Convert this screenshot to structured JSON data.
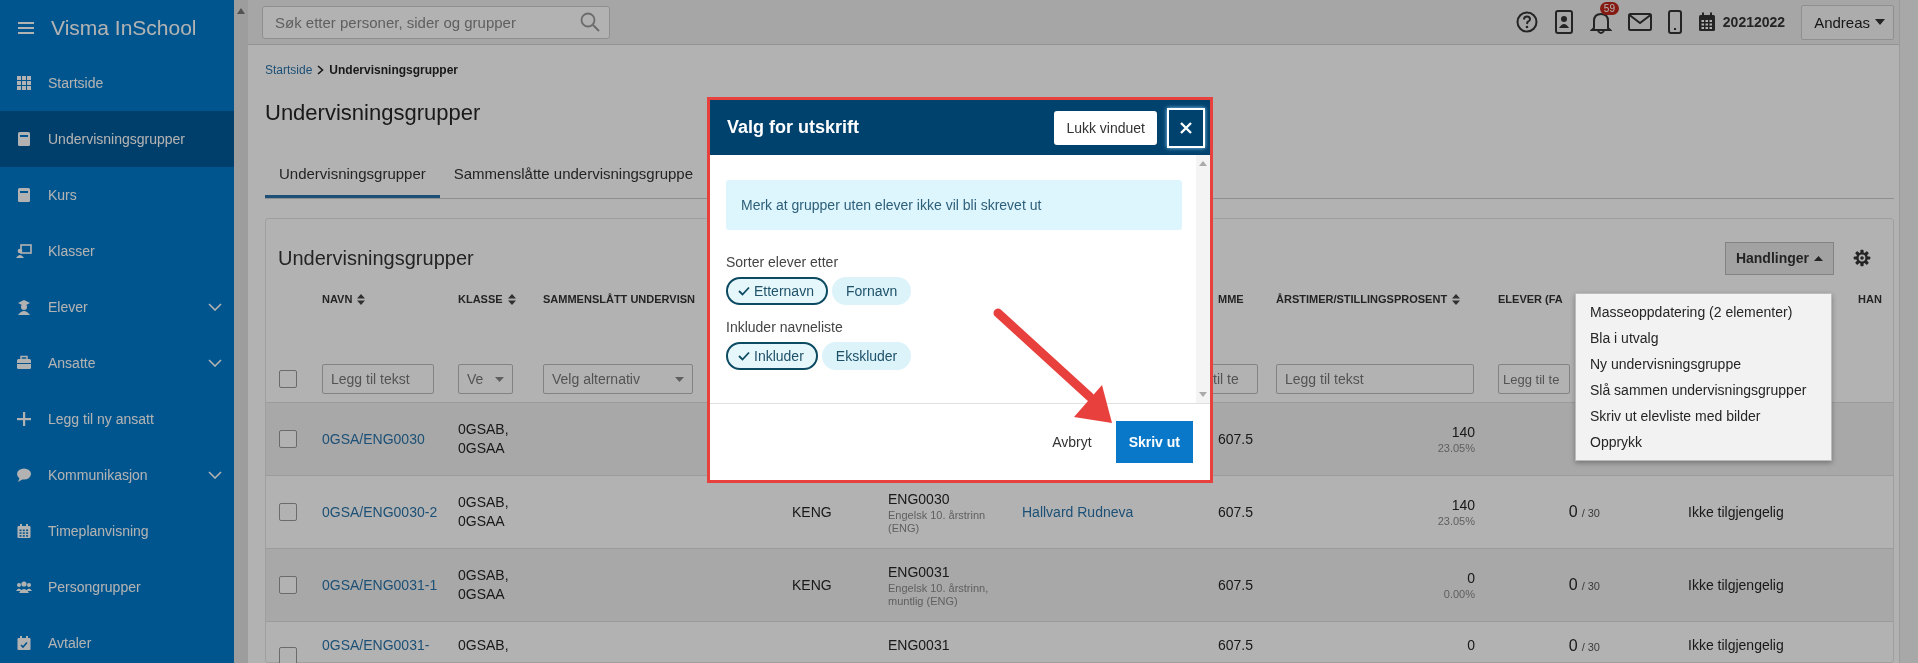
{
  "sidebar": {
    "brand": "Visma InSchool",
    "items": [
      {
        "label": "Startside",
        "selected": false,
        "has_submenu": false
      },
      {
        "label": "Undervisningsgrupper",
        "selected": true,
        "has_submenu": false
      },
      {
        "label": "Kurs",
        "selected": false,
        "has_submenu": false
      },
      {
        "label": "Klasser",
        "selected": false,
        "has_submenu": false
      },
      {
        "label": "Elever",
        "selected": false,
        "has_submenu": true
      },
      {
        "label": "Ansatte",
        "selected": false,
        "has_submenu": true
      },
      {
        "label": "Legg til ny ansatt",
        "selected": false,
        "has_submenu": false
      },
      {
        "label": "Kommunikasjon",
        "selected": false,
        "has_submenu": true
      },
      {
        "label": "Timeplanvisning",
        "selected": false,
        "has_submenu": false
      },
      {
        "label": "Persongrupper",
        "selected": false,
        "has_submenu": false
      },
      {
        "label": "Avtaler",
        "selected": false,
        "has_submenu": false
      }
    ]
  },
  "topbar": {
    "search": {
      "placeholder": "Søk etter personer, sider og grupper"
    },
    "notification_count": "59",
    "school_year": "20212022",
    "user": "Andreas"
  },
  "breadcrumb": [
    {
      "label": "Startside",
      "kind": "link"
    },
    {
      "label": "Undervisningsgrupper",
      "kind": "current"
    }
  ],
  "page_title": "Undervisningsgrupper",
  "tabs": [
    {
      "label": "Undervisningsgrupper",
      "selected": true
    },
    {
      "label": "Sammenslåtte undervisningsgruppe",
      "selected": false
    }
  ],
  "card": {
    "title": "Undervisningsgrupper",
    "actions_button": "Handlinger",
    "actions_menu": [
      "Masseoppdatering (2 elementer)",
      "Bla i utvalg",
      "Ny undervisningsgruppe",
      "Slå sammen undervisningsgrupper",
      "Skriv ut elevliste med bilder",
      "Opprykk"
    ]
  },
  "table": {
    "select_all": {
      "checked": false
    },
    "columns": [
      {
        "label": "NAVN",
        "sortable": true
      },
      {
        "label": "KLASSE",
        "sortable": true
      },
      {
        "label": "SAMMENSLÅTT UNDERVISN",
        "sortable": false
      },
      {
        "label": "MME",
        "sortable": false
      },
      {
        "label": "ÅRSTIMER/STILLINGSPROSENT",
        "sortable": true
      },
      {
        "label": "ELEVER (FA",
        "sortable": false
      },
      {
        "label": "HAN",
        "sortable": false
      }
    ],
    "filters": [
      {
        "kind": "text",
        "placeholder": "Legg til tekst"
      },
      {
        "kind": "select",
        "placeholder": "Ve"
      },
      {
        "kind": "select",
        "placeholder": "Velg alternativ"
      },
      {
        "kind": "text",
        "placeholder": "til te"
      },
      {
        "kind": "text",
        "placeholder": "Legg til tekst"
      },
      {
        "kind": "text",
        "placeholder": "Legg til te"
      }
    ],
    "rows": [
      {
        "checked": false,
        "navn": "0GSA/ENG0030",
        "klasse": "0GSAB, 0GSAA",
        "mme": "607.5",
        "arstimer": {
          "value": "140",
          "percent": "23.05%"
        }
      },
      {
        "checked": false,
        "navn": "0GSA/ENG0030-2",
        "klasse": "0GSAB, 0GSAA",
        "column_4": "KENG",
        "column_5": {
          "code": "ENG0030",
          "description": "Engelsk 10. årstrinn (ENG)"
        },
        "column_6": "Hallvard Rudneva",
        "mme": "607.5",
        "arstimer": {
          "value": "140",
          "percent": "23.05%"
        },
        "elever": {
          "count": "0",
          "total": "/ 30"
        },
        "column_11": "Ikke tilgjengelig"
      },
      {
        "checked": false,
        "navn": "0GSA/ENG0031-1",
        "klasse": "0GSAB, 0GSAA",
        "column_4": "KENG",
        "column_5": {
          "code": "ENG0031",
          "description": "Engelsk 10. årstrinn, muntlig (ENG)"
        },
        "mme": "607.5",
        "arstimer": {
          "value": "0",
          "percent": "0.00%"
        },
        "elever": {
          "count": "0",
          "total": "/ 30"
        },
        "column_11": "Ikke tilgjengelig"
      },
      {
        "checked": false,
        "navn": "0GSA/ENG0031-",
        "klasse": "0GSAB,",
        "column_5": {
          "code": "ENG0031"
        },
        "mme": "607.5",
        "arstimer": {
          "value": "0"
        },
        "elever": {
          "count": "0",
          "total": "/ 30"
        },
        "column_11": "Ikke tilgjengelig"
      }
    ]
  },
  "modal": {
    "title": "Valg for utskrift",
    "close_tooltip": "Lukk vinduet",
    "notice": "Merk at grupper uten elever ikke vil bli skrevet ut",
    "groups": [
      {
        "label": "Sorter elever etter",
        "options": [
          {
            "label": "Etternavn",
            "selected": true
          },
          {
            "label": "Fornavn",
            "selected": false
          }
        ]
      },
      {
        "label": "Inkluder navneliste",
        "options": [
          {
            "label": "Inkluder",
            "selected": true
          },
          {
            "label": "Ekskluder",
            "selected": false
          }
        ]
      }
    ],
    "cancel": "Avbryt",
    "confirm": "Skriv ut"
  }
}
